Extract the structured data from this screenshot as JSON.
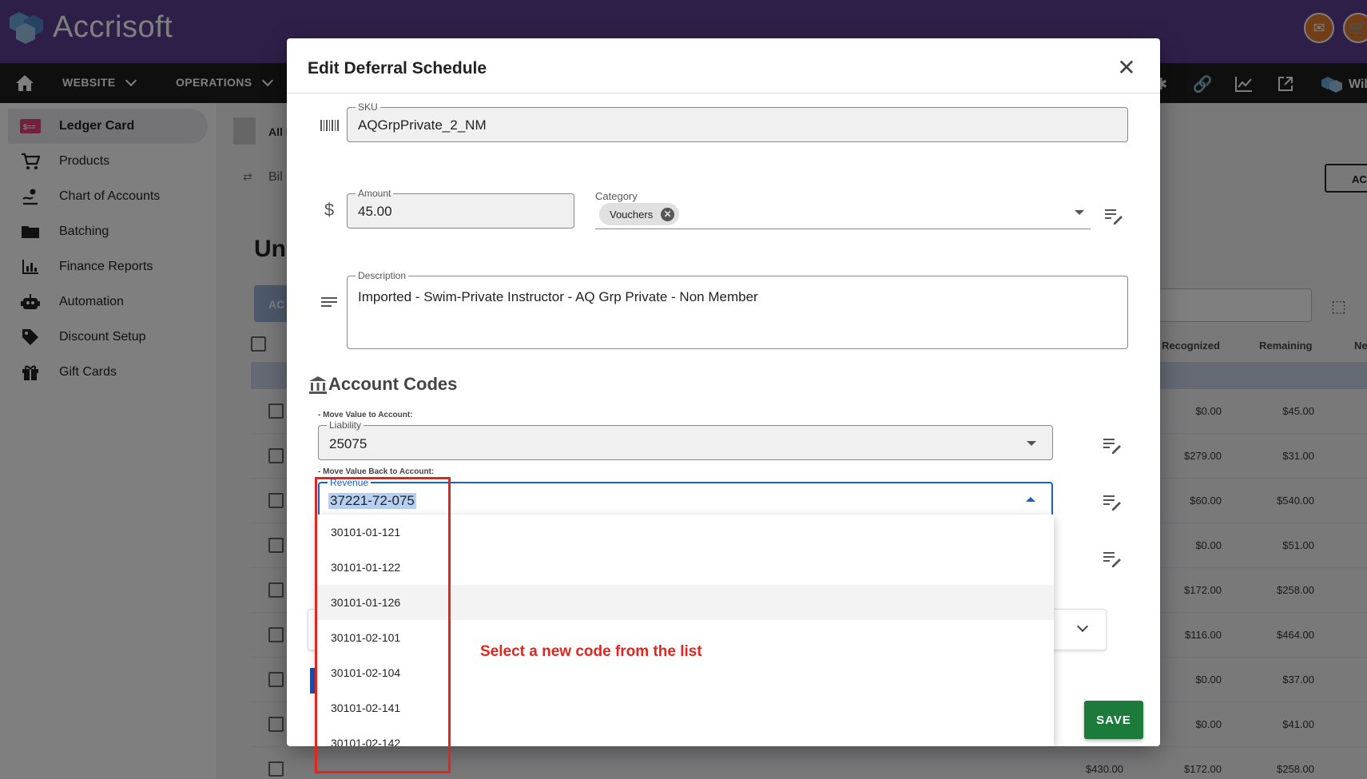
{
  "app": {
    "name": "Accrisoft"
  },
  "nav": {
    "items": [
      {
        "label": "WEBSITE"
      },
      {
        "label": "OPERATIONS"
      }
    ],
    "user_label": "Wil"
  },
  "sidebar": {
    "items": [
      {
        "label": "Ledger Card",
        "icon": "ledger-card-icon",
        "active": true
      },
      {
        "label": "Products",
        "icon": "cart-icon"
      },
      {
        "label": "Chart of Accounts",
        "icon": "chart-accounts-icon"
      },
      {
        "label": "Batching",
        "icon": "folder-icon"
      },
      {
        "label": "Finance Reports",
        "icon": "bar-chart-icon"
      },
      {
        "label": "Automation",
        "icon": "robot-icon"
      },
      {
        "label": "Discount Setup",
        "icon": "tag-icon"
      },
      {
        "label": "Gift Cards",
        "icon": "gift-icon"
      }
    ]
  },
  "background": {
    "filter_label": "All I",
    "billing_label": "Bil",
    "page_heading": "Un",
    "action_label": "ACTI",
    "tab_label": "AC",
    "columns": {
      "recognized": "Recognized",
      "remaining": "Remaining",
      "next": "Ne"
    },
    "rows": [
      {
        "recognized": "$0.00",
        "remaining": "$45.00"
      },
      {
        "recognized": "$279.00",
        "remaining": "$31.00"
      },
      {
        "recognized": "$60.00",
        "remaining": "$540.00"
      },
      {
        "recognized": "$0.00",
        "remaining": "$51.00"
      },
      {
        "recognized": "$172.00",
        "remaining": "$258.00"
      },
      {
        "recognized": "$116.00",
        "remaining": "$464.00"
      },
      {
        "recognized": "$0.00",
        "remaining": "$37.00"
      },
      {
        "recognized": "$0.00",
        "remaining": "$41.00"
      },
      {
        "amount": "$430.00",
        "recognized": "$172.00",
        "remaining": "$258.00"
      }
    ]
  },
  "modal": {
    "title": "Edit Deferral Schedule",
    "close_symbol": "✕",
    "sku": {
      "label": "SKU",
      "value": "AQGrpPrivate_2_NM"
    },
    "amount": {
      "label": "Amount",
      "value": "45.00",
      "icon_symbol": "$"
    },
    "category": {
      "label": "Category",
      "chip": "Vouchers"
    },
    "description": {
      "label": "Description",
      "value": "Imported - Swim-Private Instructor - AQ Grp Private - Non Member"
    },
    "account_codes": {
      "title": "Account Codes",
      "move_to_label": "- Move Value to Account:",
      "liability": {
        "label": "Liability",
        "value": "25075"
      },
      "move_back_label": "- Move Value Back to Account:",
      "revenue": {
        "label": "Revenue",
        "value": "37221-72-075"
      }
    },
    "dropdown_options": [
      "30101-01-121",
      "30101-01-122",
      "30101-01-126",
      "30101-02-101",
      "30101-02-104",
      "30101-02-141",
      "30101-02-142"
    ],
    "save_label": "SAVE"
  },
  "annotation": {
    "callout": "Select a new code from the list",
    "color": "#e0261f"
  },
  "colors": {
    "brand_purple": "#5c3f91",
    "nav_dark": "#1e1e1e",
    "save_green": "#1c7a3a",
    "focus_blue": "#1a5fc4"
  }
}
